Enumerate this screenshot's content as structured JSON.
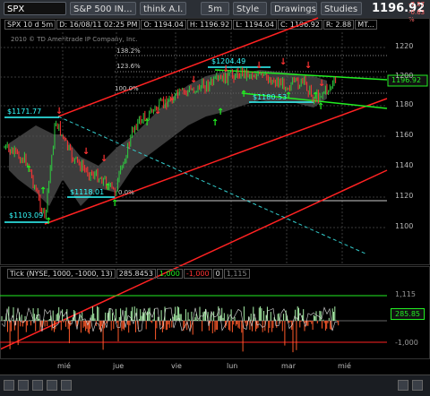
{
  "toolbar": {
    "symbol": "SPX",
    "study": "S&P 500 IN...",
    "think_ai": "think A.I.",
    "timeframe": "5m",
    "style": "Style",
    "drawings": "Drawings",
    "studies": "Studies",
    "last": "1196.92",
    "change": "-7.57",
    "change_pct": "-0.63 %"
  },
  "info": {
    "symbol": "SPX 10 d 5m",
    "datetime": "D: 16/08/11 02:25 PM",
    "open": "O: 1194.04",
    "high": "H: 1196.92",
    "low": "L: 1194.04",
    "close": "C: 1196.92",
    "range": "R: 2.88",
    "mt": "MT..."
  },
  "copyright": "2010 © TD Ameritrade IP Company, Inc.",
  "labels": {
    "l1": "$1171.77",
    "l2": "$1118.01",
    "l3": "$1103.09",
    "l4": "$1204.49",
    "l5": "$1180.53",
    "f1": "138.2%",
    "f2": "123.6%",
    "f3": "100.0%",
    "f4": "0.0%",
    "price_tag": "1196.92"
  },
  "y_axis": [
    "1220",
    "1200",
    "1180",
    "1160",
    "1140",
    "1120",
    "1100"
  ],
  "tick_info": {
    "name": "Tick (NYSE, 1000, -1000, 13)",
    "v1": "285.8453",
    "v2": "1,000",
    "v3": "-1,000",
    "v4": "0",
    "v5": "1,115"
  },
  "tick_axis": {
    "top": "1,115",
    "mid": "285.85",
    "bottom": "-1,000"
  },
  "x_axis": [
    "mié",
    "jue",
    "vie",
    "lun",
    "mar",
    "mié"
  ],
  "colors": {
    "up": "#2ecc40",
    "down": "#ff3333",
    "channel": "#ff2222",
    "green_line": "#22ee22",
    "cyan": "#33ffff"
  }
}
